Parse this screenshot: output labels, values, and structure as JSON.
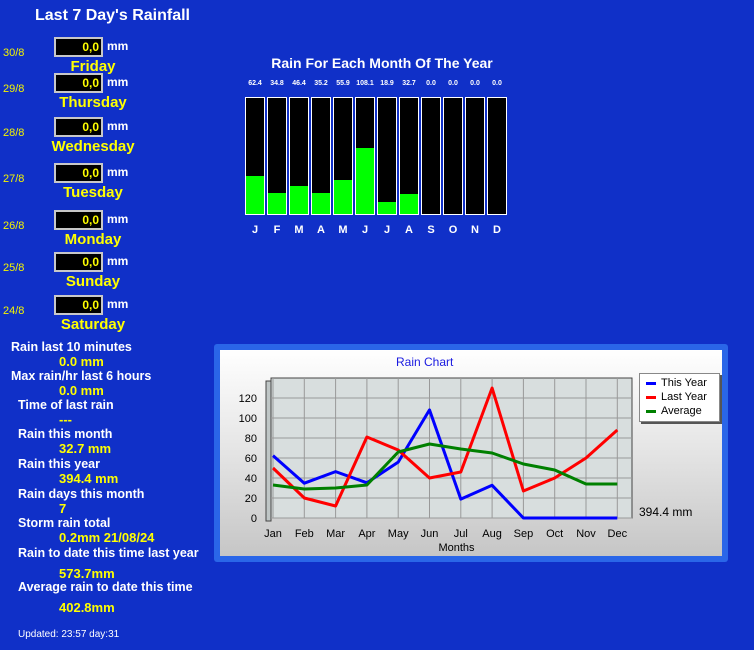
{
  "title": "Last 7 Day's Rainfall",
  "unit": "mm",
  "days": [
    {
      "date": "30/8",
      "value": "0,0",
      "name": "Friday"
    },
    {
      "date": "29/8",
      "value": "0,0",
      "name": "Thursday"
    },
    {
      "date": "28/8",
      "value": "0,0",
      "name": "Wednesday"
    },
    {
      "date": "27/8",
      "value": "0,0",
      "name": "Tuesday"
    },
    {
      "date": "26/8",
      "value": "0,0",
      "name": "Monday"
    },
    {
      "date": "25/8",
      "value": "0,0",
      "name": "Sunday"
    },
    {
      "date": "24/8",
      "value": "0,0",
      "name": "Saturday"
    }
  ],
  "stats": [
    {
      "label": "Rain last 10 minutes",
      "value": "0.0 mm"
    },
    {
      "label": "Max rain/hr last 6 hours",
      "value": "0.0 mm"
    },
    {
      "label": "Time of last rain",
      "value": "---"
    },
    {
      "label": "Rain this month",
      "value": "32.7 mm"
    },
    {
      "label": "Rain this year",
      "value": "394.4 mm"
    },
    {
      "label": "Rain days this month",
      "value": "7"
    },
    {
      "label": "Storm rain total",
      "value": "0.2mm 21/08/24"
    },
    {
      "label": "Rain to date this time last year",
      "value": "573.7mm"
    },
    {
      "label": "Average rain to date this time",
      "value": "402.8mm"
    }
  ],
  "updated": "Updated: 23:57 day:31",
  "monthly_bars": {
    "title": "Rain For Each Month Of The Year",
    "value_labels": [
      "62.4",
      "34.8",
      "46.4",
      "35.2",
      "55.9",
      "108.1",
      "18.9",
      "32.7",
      "0.0",
      "0.0",
      "0.0",
      "0.0"
    ],
    "months": [
      "J",
      "F",
      "M",
      "A",
      "M",
      "J",
      "J",
      "A",
      "S",
      "O",
      "N",
      "D"
    ],
    "max": 190,
    "bar_color": "#00ff00",
    "bg_color": "#000000"
  },
  "chart_data": {
    "type": "line",
    "title": "Rain Chart",
    "categories": [
      "Jan",
      "Feb",
      "Mar",
      "Apr",
      "May",
      "Jun",
      "Jul",
      "Aug",
      "Sep",
      "Oct",
      "Nov",
      "Dec"
    ],
    "xlabel": "Months",
    "ylabel": "",
    "ylim": [
      0,
      140
    ],
    "yticks": [
      0,
      20,
      40,
      60,
      80,
      100,
      120
    ],
    "grid": true,
    "legend_placement": "top-right",
    "series": [
      {
        "name": "This Year",
        "color": "#0000ff",
        "values": [
          62.4,
          34.8,
          46.4,
          35.2,
          55.9,
          108.1,
          18.9,
          32.7,
          0,
          0,
          0,
          0
        ]
      },
      {
        "name": "Last Year",
        "color": "#ff0000",
        "values": [
          50,
          20,
          12,
          81,
          68,
          40,
          46,
          130,
          27,
          40,
          60,
          88
        ]
      },
      {
        "name": "Average",
        "color": "#008000",
        "values": [
          33,
          29,
          30,
          33,
          66,
          74,
          69,
          65,
          54,
          48,
          34,
          34
        ]
      }
    ],
    "total_label": "394.4 mm"
  }
}
